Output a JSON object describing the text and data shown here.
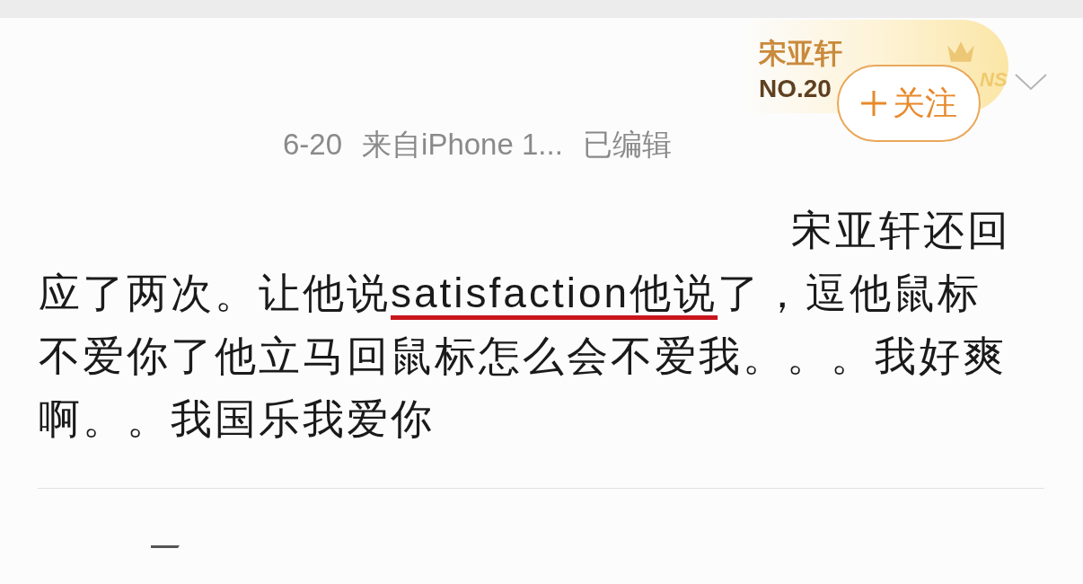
{
  "badge": {
    "name": "宋亚轩",
    "rank": "NO.20",
    "suffix": "NS"
  },
  "follow_button": {
    "label": "关注"
  },
  "meta": {
    "date": "6-20",
    "source": "来自iPhone 1...",
    "edited": "已编辑"
  },
  "post": {
    "segments": [
      {
        "text": "宋亚轩还回应了两次。让他说",
        "underlined": false
      },
      {
        "text": "satisfaction他说",
        "underlined": true
      },
      {
        "text": "了，逗他鼠标不爱你了他立马回鼠标怎么会不爱我。。。我好爽啊。。我国乐我爱你",
        "underlined": false
      }
    ]
  }
}
